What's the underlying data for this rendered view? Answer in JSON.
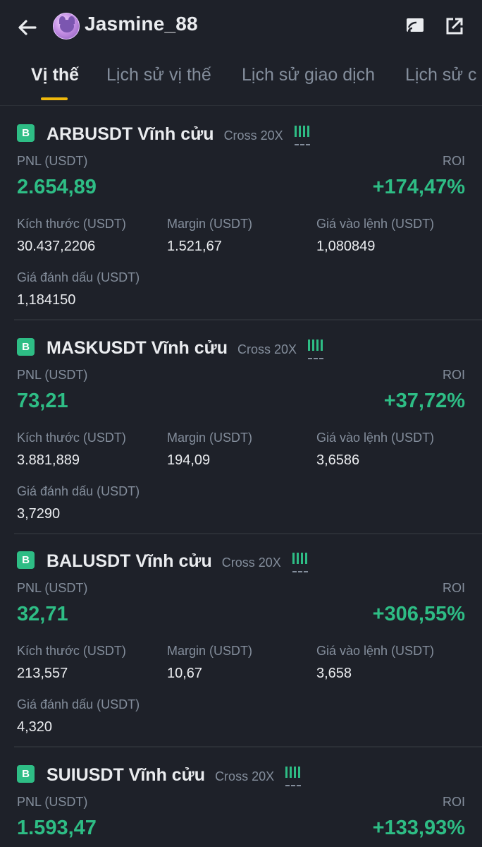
{
  "header": {
    "username": "Jasmine_88",
    "icons": [
      "back-arrow-icon",
      "cast-icon",
      "share-icon"
    ]
  },
  "tabs": [
    {
      "label": "Vị thế",
      "active": true
    },
    {
      "label": "Lịch sử vị thế",
      "active": false
    },
    {
      "label": "Lịch sử giao dịch",
      "active": false
    },
    {
      "label": "Lịch sử c",
      "active": false
    }
  ],
  "labels": {
    "pnl": "PNL (USDT)",
    "roi": "ROI",
    "size": "Kích thước (USDT)",
    "margin": "Margin (USDT)",
    "entry": "Giá vào lệnh (USDT)",
    "mark": "Giá đánh dấu (USDT)"
  },
  "colors": {
    "background": "#1e2129",
    "profit_green": "#2ebd85",
    "accent_yellow": "#f0b90b",
    "muted_text": "#848e9c"
  },
  "positions": [
    {
      "badge": "B",
      "symbol": "ARBUSDT Vĩnh cửu",
      "margin_mode": "Cross 20X",
      "pnl": "2.654,89",
      "roi": "+174,47%",
      "size": "30.437,2206",
      "margin": "1.521,67",
      "entry_price": "1,080849",
      "mark_price": "1,184150"
    },
    {
      "badge": "B",
      "symbol": "MASKUSDT Vĩnh cửu",
      "margin_mode": "Cross 20X",
      "pnl": "73,21",
      "roi": "+37,72%",
      "size": "3.881,889",
      "margin": "194,09",
      "entry_price": "3,6586",
      "mark_price": "3,7290"
    },
    {
      "badge": "B",
      "symbol": "BALUSDT Vĩnh cửu",
      "margin_mode": "Cross 20X",
      "pnl": "32,71",
      "roi": "+306,55%",
      "size": "213,557",
      "margin": "10,67",
      "entry_price": "3,658",
      "mark_price": "4,320"
    },
    {
      "badge": "B",
      "symbol": "SUIUSDT Vĩnh cửu",
      "margin_mode": "Cross 20X",
      "pnl": "1.593,47",
      "roi": "+133,93%"
    }
  ]
}
